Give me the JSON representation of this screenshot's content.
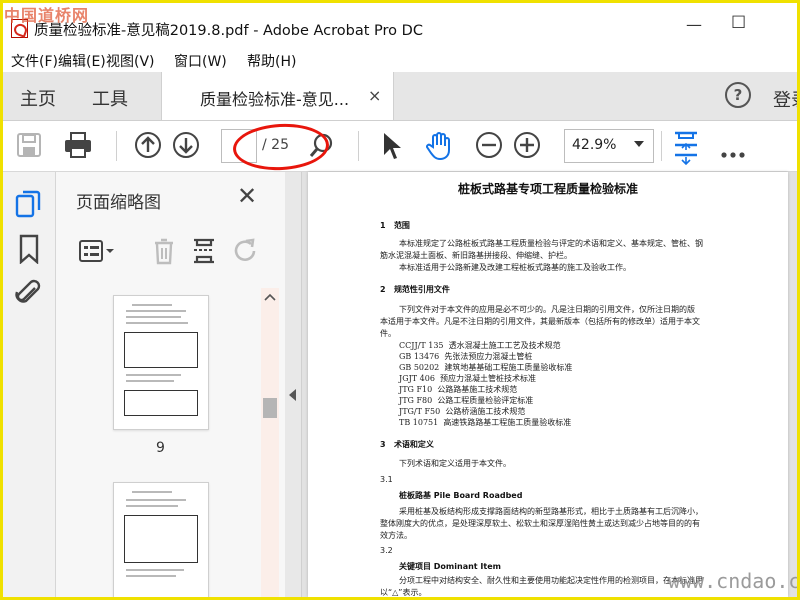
{
  "watermark_top": "中国道桥网",
  "window": {
    "title": "质量检验标准-意见稿2019.8.pdf - Adobe Acrobat Pro DC",
    "minimize": "—",
    "maximize": "☐"
  },
  "menu": [
    "文件(F)",
    "编辑(E)",
    "视图(V)",
    "窗口(W)",
    "帮助(H)"
  ],
  "tabs": {
    "home": "主页",
    "tools": "工具",
    "document": "质量检验标准-意见...",
    "document_close": "×",
    "help": "?",
    "login": "登录"
  },
  "toolbar": {
    "current_page": "",
    "page_total": "/ 25",
    "zoom": "42.9%"
  },
  "thumbnails_panel": {
    "title": "页面缩略图",
    "close": "✕",
    "pages": [
      "9"
    ]
  },
  "document": {
    "title": "桩板式路基专项工程质量检验标准",
    "sections": [
      {
        "num": "1",
        "heading": "范围"
      },
      {
        "num": "2",
        "heading": "规范性引用文件"
      },
      {
        "num": "3",
        "heading": "术语和定义"
      }
    ],
    "p1a": "本标准规定了公路桩板式路基工程质量检验与评定的术语和定义、基本规定、管桩、钢",
    "p1b": "筋水泥混凝土面板、新旧路基拼接段、伸缩缝、护栏。",
    "p1c": "本标准适用于公路新建及改建工程桩板式路基的施工及验收工作。",
    "p2a": "下列文件对于本文件的应用是必不可少的。凡是注日期的引用文件，仅所注日期的版",
    "p2b": "本适用于本文件。凡是不注日期的引用文件，其最新版本（包括所有的修改单）适用于本文",
    "p2c": "件。",
    "refs": [
      {
        "code": "CCJJ/T 135",
        "name": "透水混凝土施工工艺及技术规范"
      },
      {
        "code": "GB 13476",
        "name": "先张法预应力混凝土管桩"
      },
      {
        "code": "GB 50202",
        "name": "建筑地基基础工程施工质量验收标准"
      },
      {
        "code": "JGJT 406",
        "name": "预应力混凝土管桩技术标准"
      },
      {
        "code": "JTG F10",
        "name": "公路路基施工技术规范"
      },
      {
        "code": "JTG F80",
        "name": "公路工程质量检验评定标准"
      },
      {
        "code": "JTG/T F50",
        "name": "公路桥涵施工技术规范"
      },
      {
        "code": "TB 10751",
        "name": "高速铁路路基工程施工质量验收标准"
      }
    ],
    "p3": "下列术语和定义适用于本文件。",
    "t31_num": "3.1",
    "t31_term": "桩板路基  Pile Board Roadbed",
    "t31a": "采用桩基及板结构形成支撑路面结构的新型路基形式，相比于土质路基有工后沉降小，",
    "t31b": "整体刚度大的优点，是处理深厚软土、松软土和深厚湿陷性黄土或达到减少占地等目的的有",
    "t31c": "效方法。",
    "t32_num": "3.2",
    "t32_term": "关键项目  Dominant Item",
    "t32a": "分项工程中对结构安全、耐久性和主要使用功能起决定性作用的检测项目，在本标准用",
    "t32b": "以“△”表示。"
  },
  "watermark_bottom": "www.cndao.com",
  "colors": {
    "accent_red": "#e8160c",
    "acrobat_blue": "#1473e6",
    "frame": "#f0e100"
  }
}
